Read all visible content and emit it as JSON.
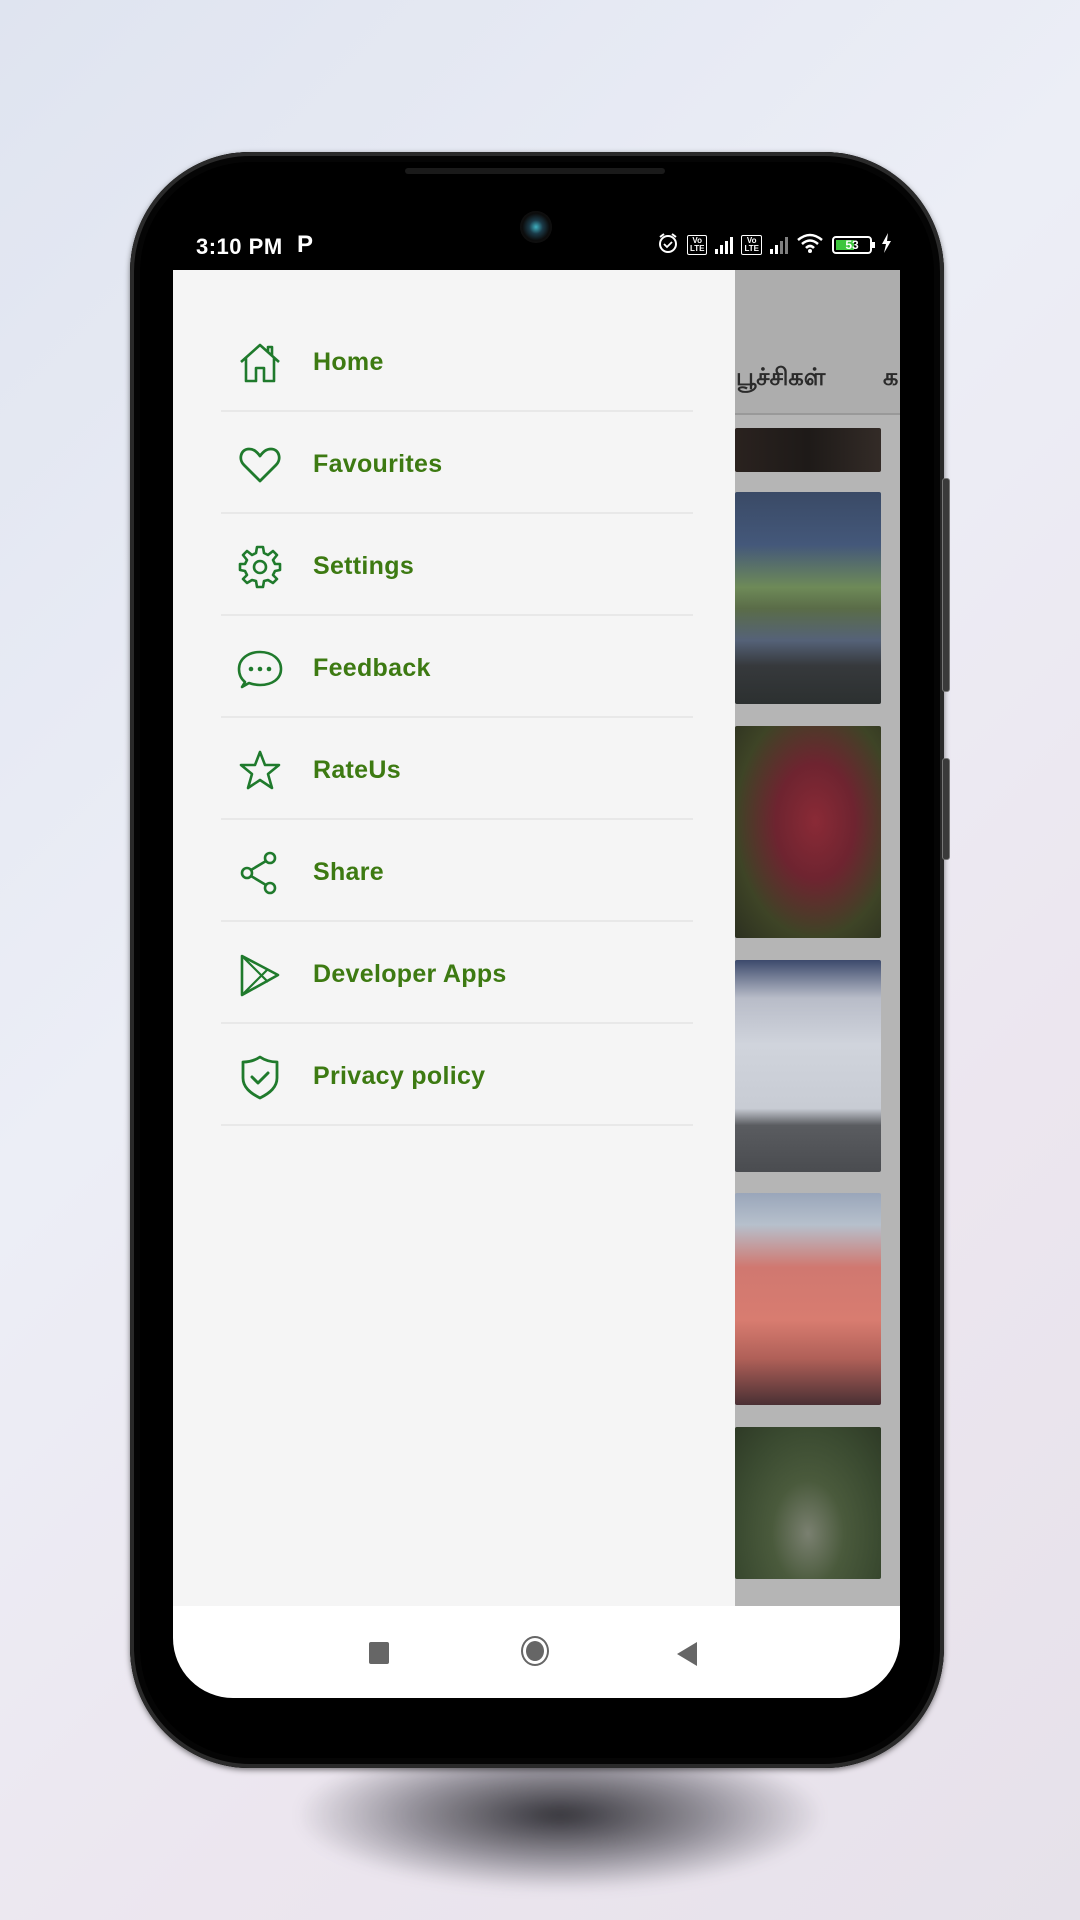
{
  "status_bar": {
    "time": "3:10 PM",
    "notification_glyph": "P",
    "icons": [
      "alarm-icon",
      "volte-icon",
      "signal-icon",
      "volte-icon",
      "signal-icon",
      "wifi-icon",
      "battery-icon",
      "charging-icon"
    ],
    "volte_label_top": "Vo",
    "volte_label_bottom": "LTE",
    "battery_percent": "53"
  },
  "background_app": {
    "tabs": [
      {
        "label": "பூச்சிகள்"
      },
      {
        "label": "க"
      }
    ],
    "thumbnails": [
      {
        "subject": "dark texture"
      },
      {
        "subject": "water lily pads"
      },
      {
        "subject": "red flower"
      },
      {
        "subject": "penguins on snow"
      },
      {
        "subject": "flamingos"
      },
      {
        "subject": "ostrich"
      }
    ]
  },
  "drawer": {
    "accent_color": "#3d7a12",
    "icon_color": "#1f7a2c",
    "items": [
      {
        "label": "Home",
        "icon": "home-icon"
      },
      {
        "label": "Favourites",
        "icon": "heart-icon"
      },
      {
        "label": "Settings",
        "icon": "gear-icon"
      },
      {
        "label": "Feedback",
        "icon": "chat-bubble-icon"
      },
      {
        "label": "RateUs",
        "icon": "star-icon"
      },
      {
        "label": "Share",
        "icon": "share-icon"
      },
      {
        "label": "Developer Apps",
        "icon": "play-store-icon"
      },
      {
        "label": "Privacy policy",
        "icon": "shield-check-icon"
      }
    ]
  },
  "nav_bar": {
    "buttons": [
      "recents",
      "home",
      "back"
    ]
  }
}
